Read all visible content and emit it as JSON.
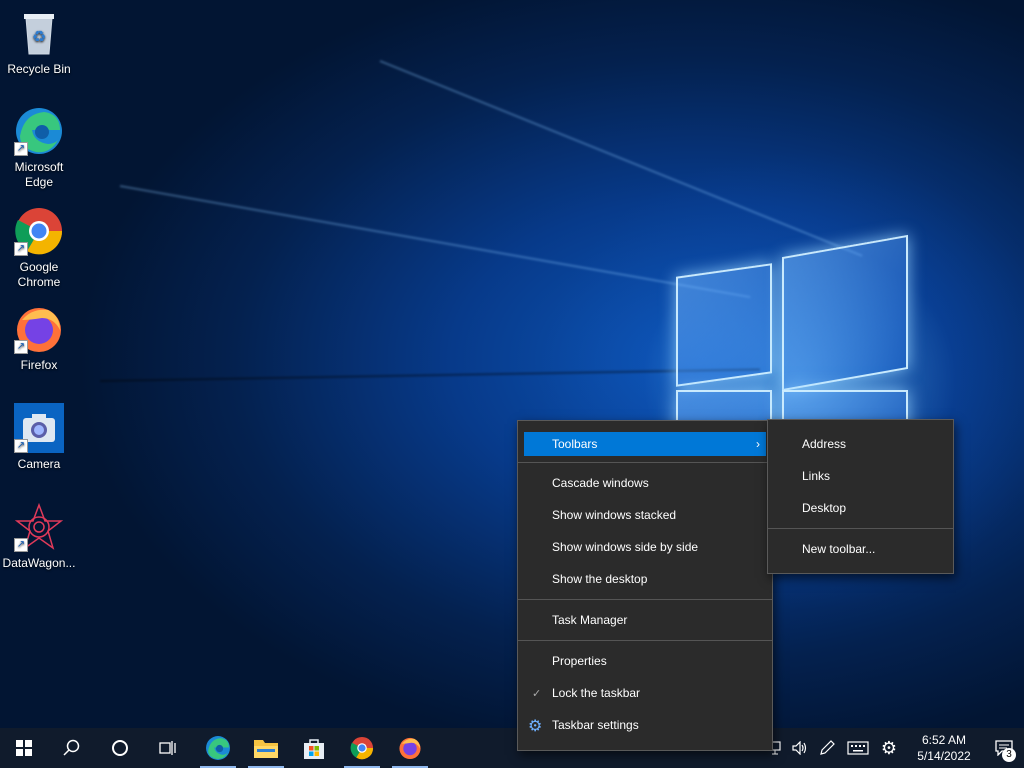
{
  "desktop": {
    "icons": [
      {
        "label": "Recycle Bin",
        "icon": "recycle-bin-icon"
      },
      {
        "label": "Microsoft\nEdge",
        "icon": "edge-icon"
      },
      {
        "label": "Google\nChrome",
        "icon": "chrome-icon"
      },
      {
        "label": "Firefox",
        "icon": "firefox-icon"
      },
      {
        "label": "Camera",
        "icon": "camera-icon"
      },
      {
        "label": "DataWagon...",
        "icon": "datawagon-icon"
      }
    ]
  },
  "context_menu": {
    "toolbars": "Toolbars",
    "cascade": "Cascade windows",
    "stacked": "Show windows stacked",
    "side_by_side": "Show windows side by side",
    "show_desktop": "Show the desktop",
    "task_manager": "Task Manager",
    "properties": "Properties",
    "lock_taskbar": "Lock the taskbar",
    "taskbar_settings": "Taskbar settings"
  },
  "toolbars_submenu": {
    "address": "Address",
    "links": "Links",
    "desktop": "Desktop",
    "new_toolbar": "New toolbar..."
  },
  "taskbar": {
    "time": "6:52 AM",
    "date": "5/14/2022",
    "notification_count": "3"
  },
  "colors": {
    "accent": "#0078d7",
    "menu_bg": "#2b2b2b",
    "taskbar_bg": "#101b2c"
  }
}
